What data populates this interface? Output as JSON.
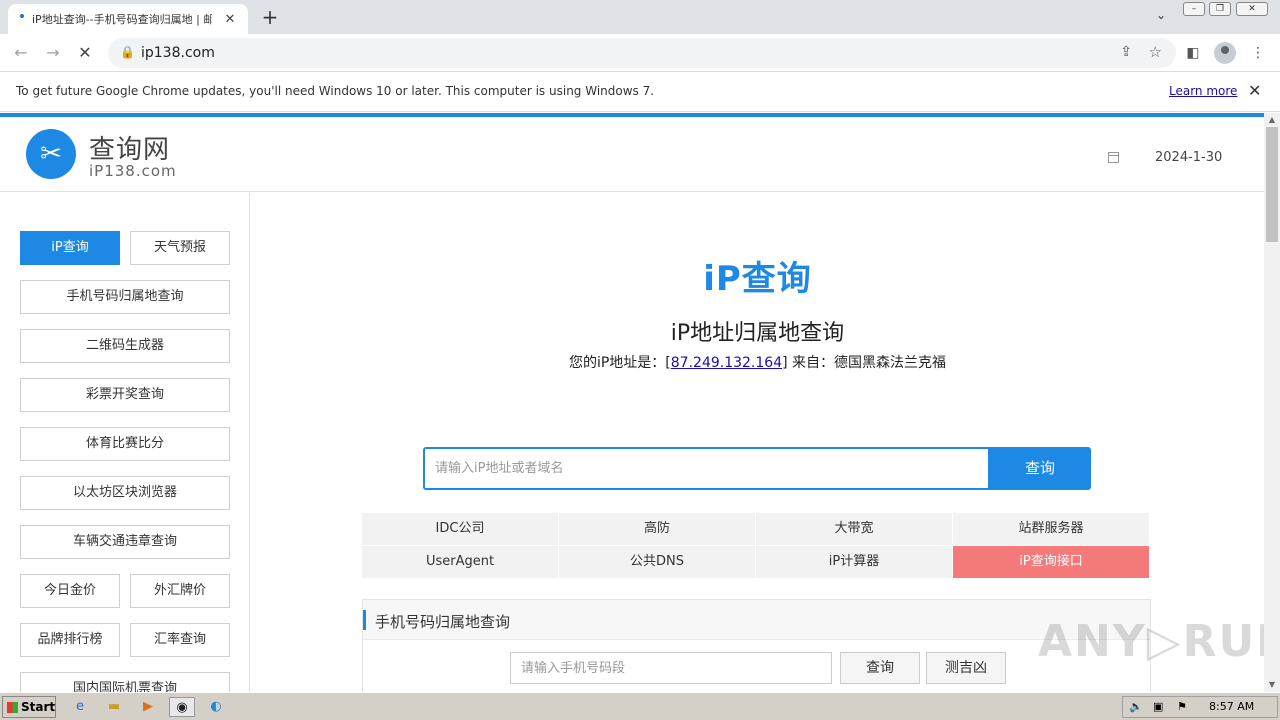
{
  "browser": {
    "tab_title": "iP地址查询--手机号码查询归属地 | 邮",
    "tab_close": "✕",
    "new_tab": "+",
    "url": "ip138.com",
    "infobar_message": "To get future Google Chrome updates, you'll need Windows 10 or later. This computer is using Windows 7.",
    "infobar_link": "Learn more",
    "infobar_close": "✕"
  },
  "header": {
    "logo_name": "查询网",
    "logo_domain": "iP138.com",
    "date": "2024-1-30"
  },
  "sidebar": {
    "items": [
      {
        "label": "iP查询",
        "active": true
      },
      {
        "label": "天气预报"
      },
      {
        "label": "手机号码归属地查询"
      },
      {
        "label": "二维码生成器"
      },
      {
        "label": "彩票开奖查询"
      },
      {
        "label": "体育比赛比分"
      },
      {
        "label": "以太坊区块浏览器"
      },
      {
        "label": "车辆交通违章查询"
      },
      {
        "label": "今日金价"
      },
      {
        "label": "外汇牌价"
      },
      {
        "label": "品牌排行榜"
      },
      {
        "label": "汇率查询"
      },
      {
        "label": "国内国际机票查询"
      }
    ]
  },
  "main": {
    "brand": "iP查询",
    "headline": "iP地址归属地查询",
    "ip_prefix": "您的iP地址是：[",
    "ip_address": "87.249.132.164",
    "ip_suffix": "] 来自：德国黑森法兰克福",
    "search_placeholder": "请输入iP地址或者域名",
    "search_button": "查询",
    "links": [
      "IDC公司",
      "高防",
      "大带宽",
      "站群服务器",
      "UserAgent",
      "公共DNS",
      "iP计算器",
      "iP查询接口"
    ],
    "phone_panel": {
      "title": "手机号码归属地查询",
      "placeholder": "请输入手机号码段",
      "query_button": "查询",
      "fortune_button": "测吉凶"
    }
  },
  "watermark": "ANY▷RUN",
  "taskbar": {
    "start": "Start",
    "time": "8:57 AM"
  },
  "colors": {
    "accent": "#1e88e5",
    "highlight_cell": "#f47a7a"
  }
}
